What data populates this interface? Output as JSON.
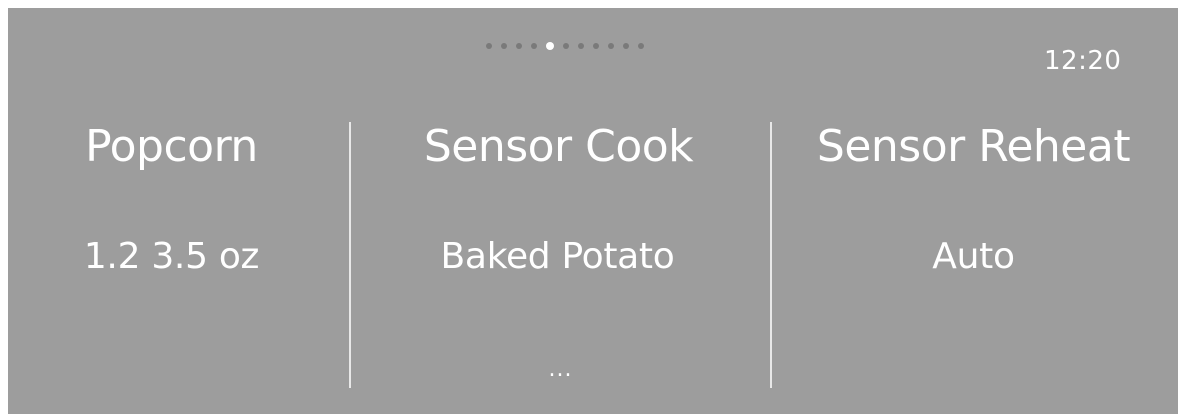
{
  "pager": {
    "total": 11,
    "active_index": 4
  },
  "status": {
    "time": "12:20"
  },
  "columns": [
    {
      "title": "Popcorn",
      "value": "1.2  3.5 oz",
      "more": ""
    },
    {
      "title": "Sensor Cook",
      "value": "Baked Potato",
      "more": "..."
    },
    {
      "title": "Sensor Reheat",
      "value": "Auto",
      "more": ""
    }
  ],
  "colors": {
    "background": "#9d9d9d",
    "text": "#ffffff",
    "dot_inactive": "#7a7a7a",
    "dot_active": "#ffffff"
  }
}
